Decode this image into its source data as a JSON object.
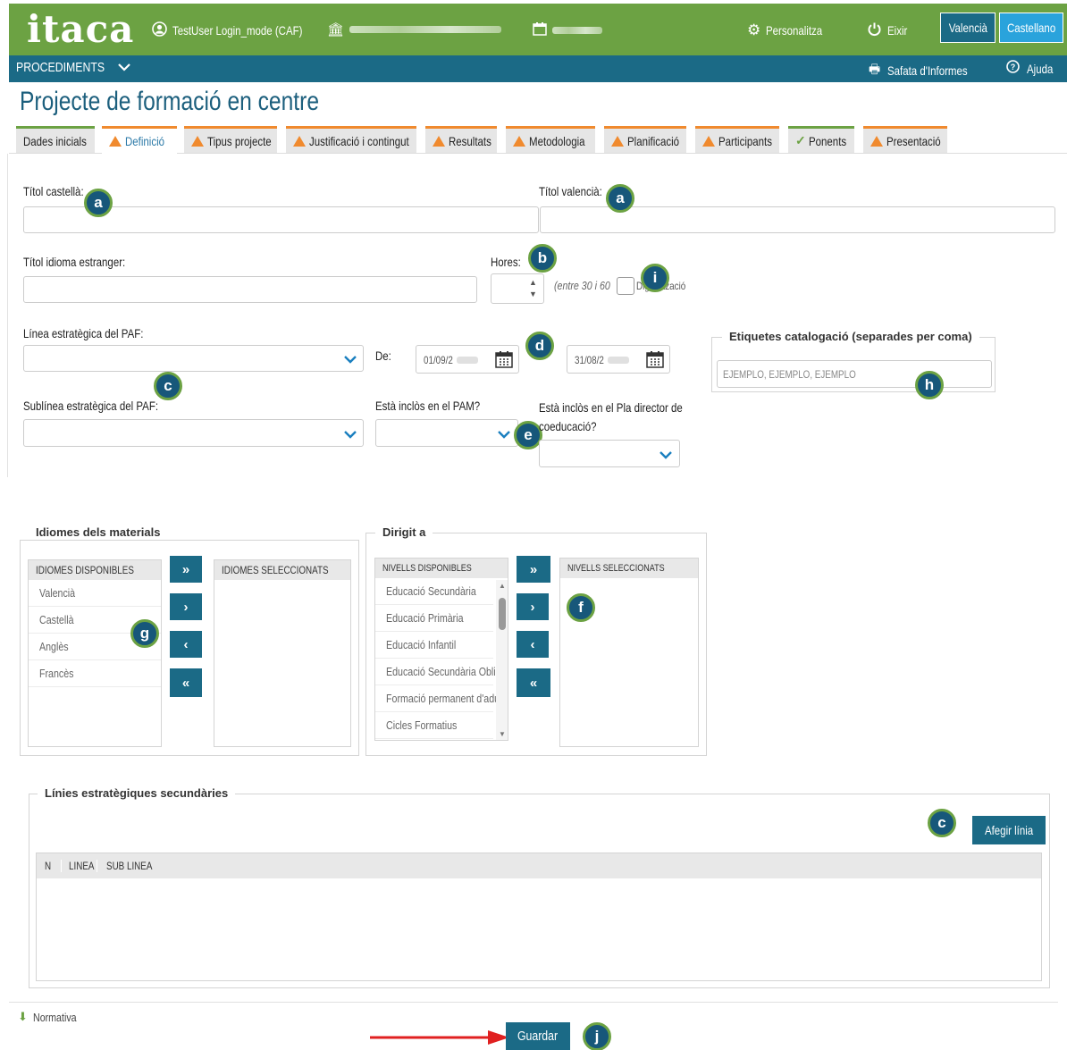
{
  "header": {
    "logo": "itaca",
    "user": "TestUser Login_mode (CAF)",
    "personalitza": "Personalitza",
    "eixir": "Eixir",
    "lang_valencia": "Valencià",
    "lang_castellano": "Castellano"
  },
  "nav": {
    "procediments": "PROCEDIMENTS",
    "safata": "Safata d'Informes",
    "ajuda": "Ajuda"
  },
  "page_title": "Projecte de formació en centre",
  "tabs": [
    {
      "label": "Dades inicials",
      "status": "none"
    },
    {
      "label": "Definició",
      "status": "warning"
    },
    {
      "label": "Tipus projecte",
      "status": "warning"
    },
    {
      "label": "Justificació i contingut",
      "status": "warning"
    },
    {
      "label": "Resultats",
      "status": "warning"
    },
    {
      "label": "Metodologia",
      "status": "warning"
    },
    {
      "label": "Planificació",
      "status": "warning"
    },
    {
      "label": "Participants",
      "status": "warning"
    },
    {
      "label": "Ponents",
      "status": "ok"
    },
    {
      "label": "Presentació",
      "status": "warning"
    }
  ],
  "form": {
    "titol_castella": "Títol castellà:",
    "titol_valencia": "Títol valencià:",
    "titol_estranger": "Títol idioma estranger:",
    "hores": "Hores:",
    "hores_hint": "(entre 30 i 60",
    "digitalitzacio": "Digitalització",
    "linea_paf": "Línea estratègica del PAF:",
    "de": "De:",
    "date_from": "01/09/2",
    "date_to": "31/08/2",
    "subline_paf": "Sublínea estratègica del PAF:",
    "inclos_pam": "Està inclòs en el PAM?",
    "inclos_pla_1": "Està inclòs en el Pla director de",
    "inclos_pla_2": "coeducació?",
    "etiquetes_legend": "Etiquetes catalogació (separades per coma)",
    "etiquetes_placeholder": "EJEMPLO, EJEMPLO, EJEMPLO"
  },
  "idiomes": {
    "legend": "Idiomes dels materials",
    "disponibles_header": "IDIOMES DISPONIBLES",
    "seleccionats_header": "IDIOMES SELECCIONATS",
    "items": [
      "Valencià",
      "Castellà",
      "Anglès",
      "Francès"
    ]
  },
  "dirigit": {
    "legend": "Dirigit a",
    "disponibles_header": "NIVELLS DISPONIBLES",
    "seleccionats_header": "NIVELLS SELECCIONATS",
    "items": [
      "Educació Secundària",
      "Educació Primària",
      "Educació Infantil",
      "Educació Secundària Obliga",
      "Formació permanent d'adu",
      "Cicles Formatius"
    ]
  },
  "transfer_buttons": {
    "all_right": "»",
    "right": "›",
    "left": "‹",
    "all_left": "«"
  },
  "linies": {
    "legend": "Línies estratègiques secundàries",
    "add_button": "Afegir línia",
    "col_n": "N",
    "col_linea": "LINEA",
    "col_subline": "SUB LINEA"
  },
  "normativa": "Normativa",
  "guardar": "Guardar",
  "badges": {
    "a": "a",
    "b": "b",
    "c": "c",
    "d": "d",
    "e": "e",
    "f": "f",
    "g": "g",
    "h": "h",
    "i": "i",
    "j": "j"
  },
  "colors": {
    "header_green": "#6ca243",
    "nav_blue": "#1b6a86",
    "warning_orange": "#f08a2e",
    "badge_navy": "#17577a",
    "arrow_red": "#e02020"
  }
}
